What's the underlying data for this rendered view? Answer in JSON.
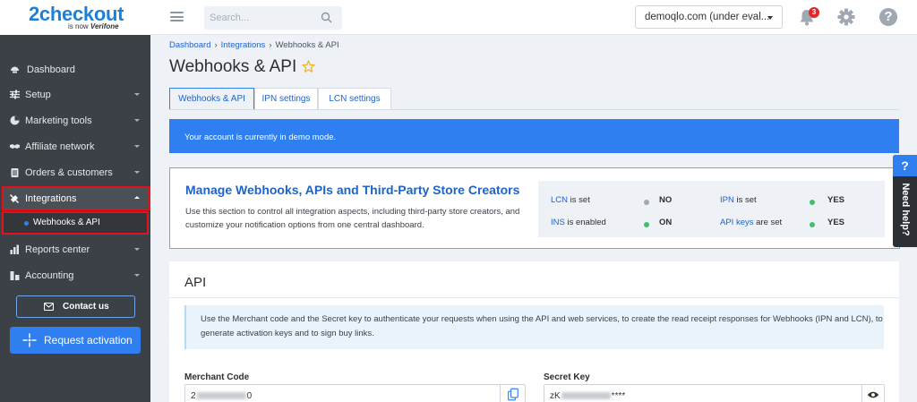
{
  "logo": {
    "main": "2checkout",
    "sub_prefix": "is now",
    "sub_brand": "Verifone"
  },
  "search": {
    "placeholder": "Search..."
  },
  "account": {
    "selected": "demoqlo.com (under eval..."
  },
  "notifications": {
    "count": "3"
  },
  "sidebar": {
    "items": [
      {
        "label": "Dashboard",
        "icon": "dashboard-icon",
        "has_caret": false
      },
      {
        "label": "Setup",
        "icon": "sliders-icon",
        "has_caret": true
      },
      {
        "label": "Marketing tools",
        "icon": "pie-chart-icon",
        "has_caret": true
      },
      {
        "label": "Affiliate network",
        "icon": "handshake-icon",
        "has_caret": true
      },
      {
        "label": "Orders & customers",
        "icon": "clipboard-icon",
        "has_caret": true
      },
      {
        "label": "Integrations",
        "icon": "plug-icon",
        "has_caret": true,
        "expanded": true
      },
      {
        "label": "Reports center",
        "icon": "bar-chart-icon",
        "has_caret": true
      },
      {
        "label": "Accounting",
        "icon": "accounting-icon",
        "has_caret": true
      }
    ],
    "sub_item": "Webhooks & API",
    "contact_label": "Contact us",
    "activation_label": "Request activation"
  },
  "breadcrumb": {
    "dashboard": "Dashboard",
    "integrations": "Integrations",
    "current": "Webhooks & API"
  },
  "page_title": "Webhooks & API",
  "tabs": [
    {
      "label": "Webhooks & API",
      "active": true
    },
    {
      "label": "IPN settings",
      "active": false
    },
    {
      "label": "LCN settings",
      "active": false
    }
  ],
  "demo_banner": "Your account is currently in demo mode.",
  "manage": {
    "title": "Manage Webhooks, APIs and Third-Party Store Creators",
    "description": "Use this section to control all integration aspects, including third-party store creators, and customize your notification options from one central dashboard.",
    "status": [
      {
        "link": "LCN",
        "text": " is set",
        "value": "NO",
        "color": "#a0a8b2"
      },
      {
        "link": "IPN",
        "text": " is set",
        "value": "YES",
        "color": "#3cc36a"
      },
      {
        "link": "INS",
        "text": " is enabled",
        "value": "ON",
        "color": "#3cc36a"
      },
      {
        "link": "API keys",
        "text": " are set",
        "value": "YES",
        "color": "#3cc36a"
      }
    ]
  },
  "need_help": {
    "q": "?",
    "label": "Need help?"
  },
  "api": {
    "title": "API",
    "info": "Use the Merchant code and the Secret key to authenticate your requests when using the API and web services, to create the read receipt responses for Webhooks (IPN and LCN), to generate activation keys and to sign buy links.",
    "merchant_label": "Merchant Code",
    "merchant_prefix": "2",
    "merchant_suffix": "0",
    "secret_label": "Secret Key",
    "secret_prefix": "zK",
    "secret_suffix": "****"
  },
  "colors": {
    "accent": "#2f7ff0",
    "sidebar": "#3c4147",
    "highlight": "#e0131d"
  }
}
